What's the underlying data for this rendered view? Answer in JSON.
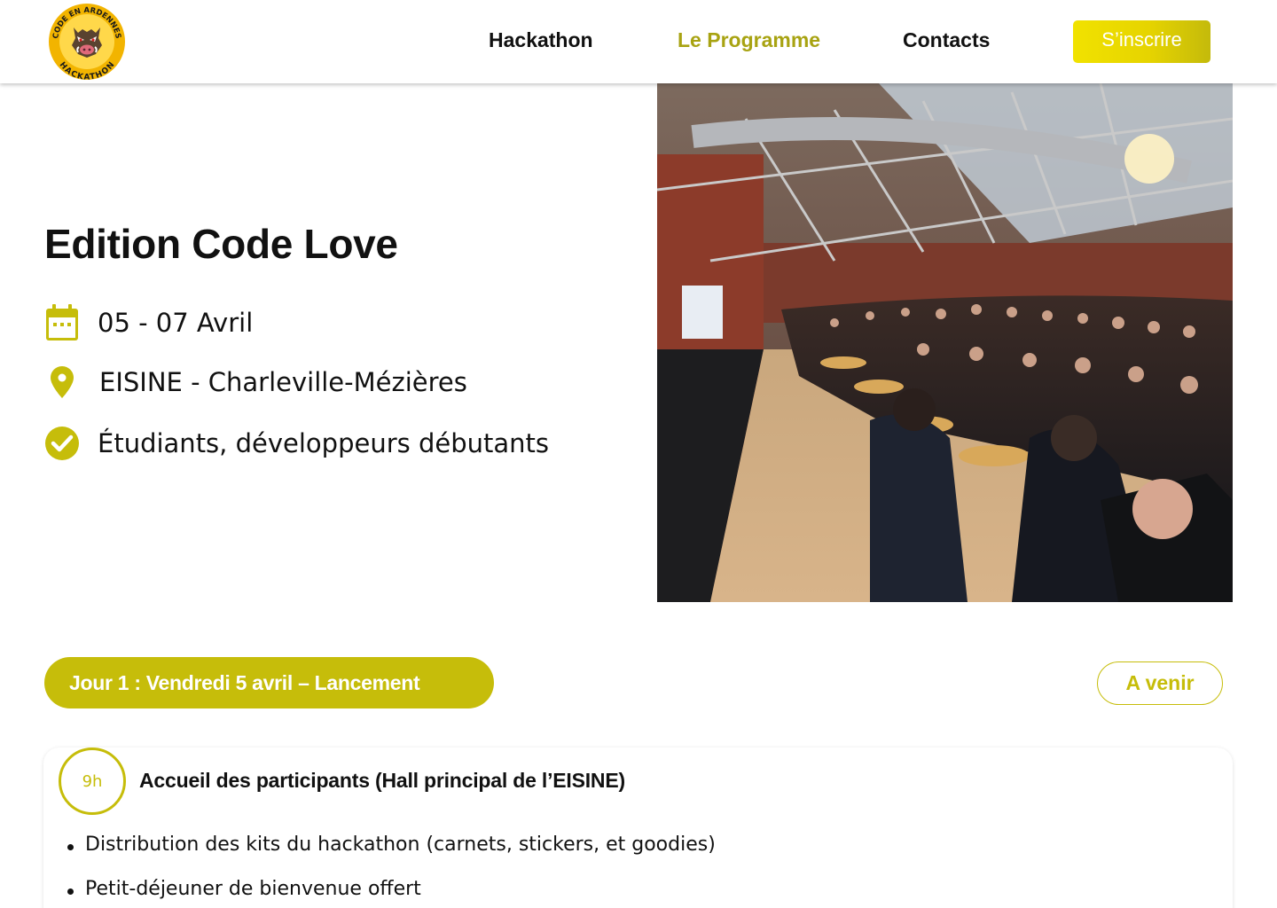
{
  "header": {
    "logo": {
      "top_text": "CODE EN ARDENNES",
      "bottom_text": "HACKATHON",
      "icon": "boar-head"
    },
    "nav": [
      {
        "label": "Hackathon",
        "active": false
      },
      {
        "label": "Le Programme",
        "active": true
      },
      {
        "label": "Contacts",
        "active": false
      }
    ],
    "cta_label": "S’inscrire"
  },
  "hero": {
    "title": "Edition Code Love",
    "details": [
      {
        "icon": "calendar-icon",
        "text": "05 - 07 Avril"
      },
      {
        "icon": "map-pin-icon",
        "text": "EISINE - Charleville-Mézières"
      },
      {
        "icon": "check-circle-icon",
        "text": "Étudiants, développeurs débutants"
      }
    ],
    "photo": "event-hall-photo"
  },
  "program": {
    "day_label": "Jour 1 : Vendredi 5 avril – Lancement",
    "status_label": "A venir",
    "events": [
      {
        "time": "9h",
        "title": "Accueil des participants (Hall principal de l’EISINE)",
        "items": [
          "Distribution des kits du hackathon (carnets, stickers, et goodies)",
          "Petit-déjeuner de bienvenue offert"
        ]
      }
    ]
  },
  "colors": {
    "accent": "#c6bd0a",
    "nav_active": "#a8a312",
    "cta_yellow": "#f1e200"
  }
}
